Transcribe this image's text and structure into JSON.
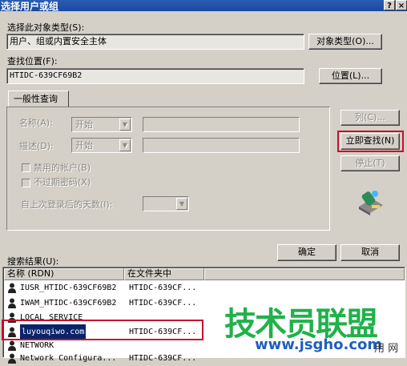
{
  "window": {
    "title": "选择用户或组",
    "help_btn": "?",
    "close_btn": "×"
  },
  "object_type": {
    "label": "选择此对象类型(S):",
    "value": "用户、组或内置安全主体",
    "button": "对象类型(O)..."
  },
  "location": {
    "label": "查找位置(F):",
    "value": "HTIDC-639CF69B2",
    "button": "位置(L)..."
  },
  "tab": {
    "label": "一般性查询"
  },
  "query": {
    "name_label": "名称(A):",
    "name_mode": "开始",
    "desc_label": "描述(D):",
    "desc_mode": "开始",
    "disabled_accounts": "禁用的帐户(B)",
    "no_expire_pwd": "不过期密码(X)",
    "days_label": "自上次登录后的天数(I):"
  },
  "side_buttons": {
    "columns": "列(C)...",
    "find_now": "立即查找(N)",
    "stop": "停止(T)"
  },
  "dialog_buttons": {
    "ok": "确定",
    "cancel": "取消"
  },
  "results": {
    "label": "搜索结果(U):",
    "columns": [
      "名称 (RDN)",
      "在文件夹中"
    ],
    "rows": [
      {
        "name": "IUSR_HTIDC-639CF69B2",
        "folder": "HTIDC-639CF...",
        "selected": false
      },
      {
        "name": "IWAM_HTIDC-639CF69B2",
        "folder": "HTIDC-639CF...",
        "selected": false
      },
      {
        "name": "LOCAL SERVICE",
        "folder": "",
        "selected": false
      },
      {
        "name": "luyouqiwo.com",
        "folder": "HTIDC-639CF...",
        "selected": true
      },
      {
        "name": "NETWORK",
        "folder": "",
        "selected": false
      },
      {
        "name": "Network Configura...",
        "folder": "HTIDC-639CF...",
        "selected": false
      }
    ]
  },
  "watermark": {
    "main": "技术员联盟",
    "url": "www.jsgho.com",
    "partial": "用 网"
  },
  "colors": {
    "title_bar": "#1c49a0",
    "selection": "#0a246a",
    "highlight_red": "#c8102e",
    "watermark_green": "#21b14b",
    "watermark_blue": "#1f5fbf"
  }
}
